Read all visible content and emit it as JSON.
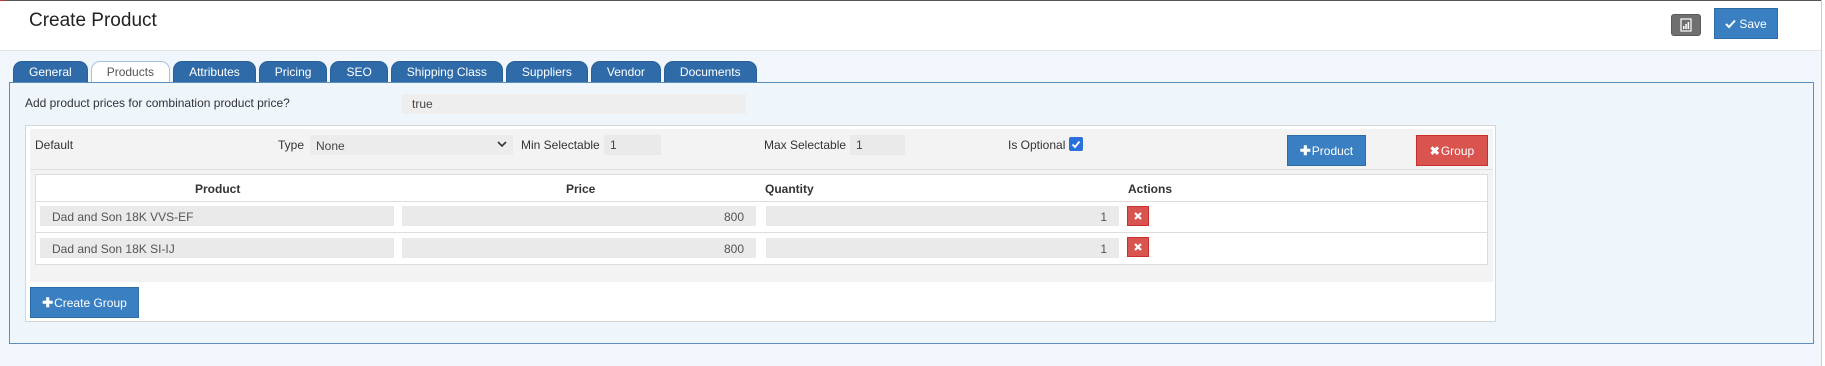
{
  "header": {
    "title": "Create Product",
    "report_icon": "report-chart-icon",
    "save_label": "Save"
  },
  "tabs": [
    {
      "label": "General",
      "active": false
    },
    {
      "label": "Products",
      "active": true
    },
    {
      "label": "Attributes",
      "active": false
    },
    {
      "label": "Pricing",
      "active": false
    },
    {
      "label": "SEO",
      "active": false
    },
    {
      "label": "Shipping Class",
      "active": false
    },
    {
      "label": "Suppliers",
      "active": false
    },
    {
      "label": "Vendor",
      "active": false
    },
    {
      "label": "Documents",
      "active": false
    }
  ],
  "combination": {
    "label": "Add product prices for combination product price?",
    "value": "true"
  },
  "group": {
    "name": "Default",
    "type_label": "Type",
    "type_value": "None",
    "min_label": "Min Selectable",
    "min_value": "1",
    "max_label": "Max Selectable",
    "max_value": "1",
    "optional_label": "Is Optional",
    "optional_checked": true,
    "add_product_label": "Product",
    "delete_group_label": "Group"
  },
  "table": {
    "columns": [
      "Product",
      "Price",
      "Quantity",
      "Actions"
    ],
    "rows": [
      {
        "product": "Dad and Son 18K VVS-EF",
        "price": "800",
        "quantity": "1"
      },
      {
        "product": "Dad and Son 18K SI-IJ",
        "price": "800",
        "quantity": "1"
      }
    ]
  },
  "create_group_label": "Create Group",
  "colors": {
    "primary": "#3a7fc1",
    "danger": "#d9534f",
    "tab": "#2f6ba8",
    "panel_border": "#5b8dbd"
  }
}
